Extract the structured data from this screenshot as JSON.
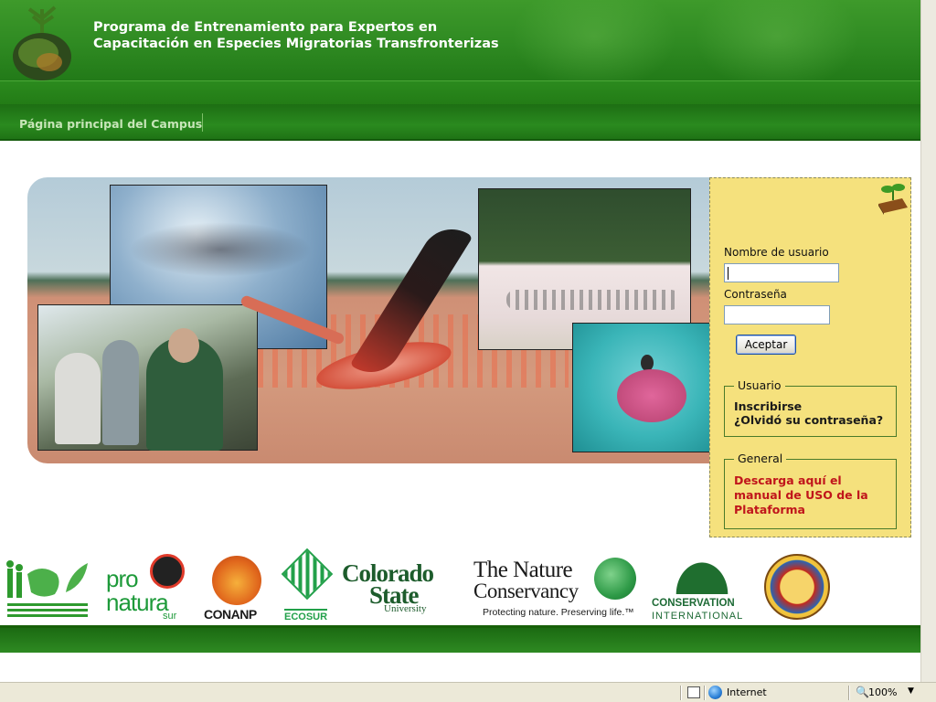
{
  "header": {
    "title_line1": "Programa de Entrenamiento para Expertos en",
    "title_line2": "Capacitación en Especies Migratorias Transfronterizas"
  },
  "nav": {
    "home_link": "Página principal del Campus"
  },
  "login": {
    "username_label": "Nombre de usuario",
    "username_value": "",
    "password_label": "Contraseña",
    "password_value": "",
    "submit_label": "Aceptar"
  },
  "user_box": {
    "legend": "Usuario",
    "signup_link": "Inscribirse",
    "forgot_link": "¿Olvidó su contraseña?"
  },
  "general_box": {
    "legend": "General",
    "manual_link": "Descarga aquí el manual de USO de la Plataforma"
  },
  "sponsors": {
    "pronatura": {
      "line1": "pro",
      "line2": "natura",
      "line3": "sur"
    },
    "conanp": "CONANP",
    "ecosur": "ECOSUR",
    "colorado": {
      "line1": "Colorado",
      "line2": "State",
      "line3": "University"
    },
    "tnc": {
      "line1": "The Nature",
      "line2": "Conservancy",
      "tagline": "Protecting nature. Preserving life.™"
    },
    "ci": {
      "line1": "CONSERVATION",
      "line2": "INTERNATIONAL"
    }
  },
  "statusbar": {
    "zone": "Internet",
    "zoom": "100%"
  },
  "colors": {
    "header_green": "#2f8a22",
    "login_panel": "#f5e17d",
    "manual_link": "#c0151b"
  }
}
